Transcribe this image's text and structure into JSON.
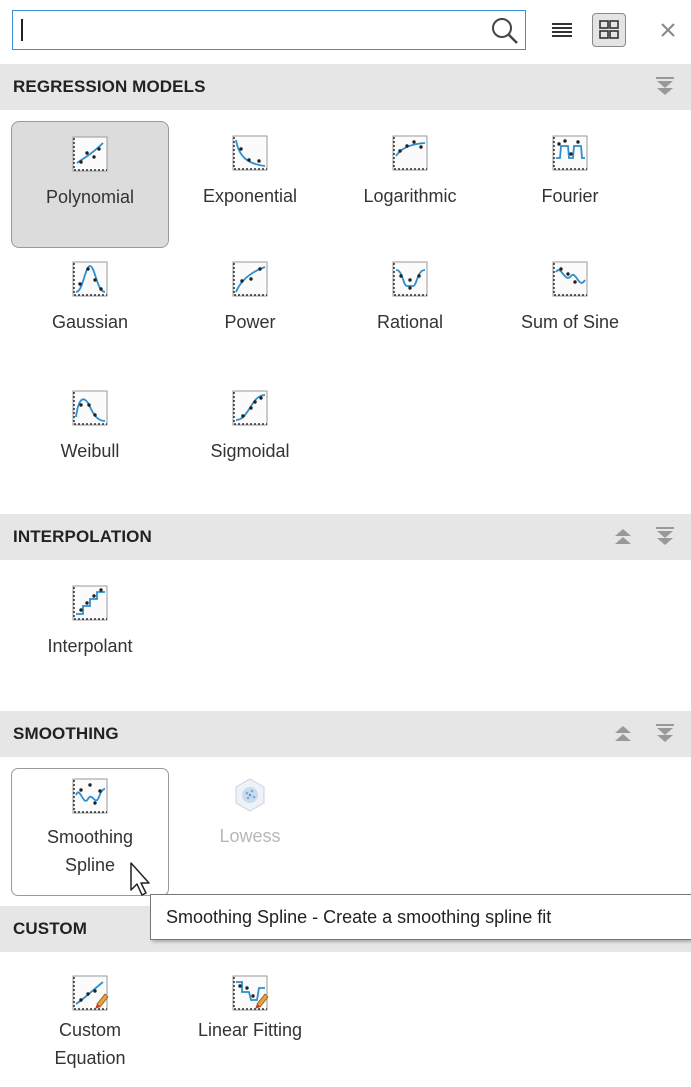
{
  "search": {
    "value": "",
    "placeholder": ""
  },
  "toolbar": {
    "search_icon": "search-icon",
    "list_view_icon": "list-view-icon",
    "grid_view_icon": "grid-view-icon",
    "close_icon": "close-icon"
  },
  "sections": {
    "regression": {
      "title": "REGRESSION MODELS",
      "items": [
        {
          "label": "Polynomial",
          "icon": "polynomial-fit-icon",
          "state": "selected"
        },
        {
          "label": "Exponential",
          "icon": "exponential-fit-icon"
        },
        {
          "label": "Logarithmic",
          "icon": "logarithmic-fit-icon"
        },
        {
          "label": "Fourier",
          "icon": "fourier-fit-icon"
        },
        {
          "label": "Gaussian",
          "icon": "gaussian-fit-icon"
        },
        {
          "label": "Power",
          "icon": "power-fit-icon"
        },
        {
          "label": "Rational",
          "icon": "rational-fit-icon"
        },
        {
          "label": "Sum of Sine",
          "icon": "sum-of-sine-fit-icon"
        },
        {
          "label": "Weibull",
          "icon": "weibull-fit-icon"
        },
        {
          "label": "Sigmoidal",
          "icon": "sigmoidal-fit-icon"
        }
      ]
    },
    "interpolation": {
      "title": "INTERPOLATION",
      "items": [
        {
          "label": "Interpolant",
          "icon": "interpolant-fit-icon"
        }
      ]
    },
    "smoothing": {
      "title": "SMOOTHING",
      "items": [
        {
          "label_line1": "Smoothing",
          "label_line2": "Spline",
          "icon": "smoothing-spline-icon",
          "state": "hovered"
        },
        {
          "label": "Lowess",
          "icon": "lowess-icon",
          "state": "disabled"
        }
      ]
    },
    "custom": {
      "title": "CUSTOM",
      "items": [
        {
          "label_line1": "Custom",
          "label_line2": "Equation",
          "icon": "custom-equation-icon"
        },
        {
          "label": "Linear Fitting",
          "icon": "linear-fitting-icon"
        }
      ]
    }
  },
  "tooltip": {
    "text": "Smoothing Spline - Create a smoothing spline fit"
  },
  "colors": {
    "accent": "#3a8fd6",
    "curve": "#2f8fce",
    "header_bg": "#e6e6e6",
    "selected_bg": "#dcdcdc"
  }
}
